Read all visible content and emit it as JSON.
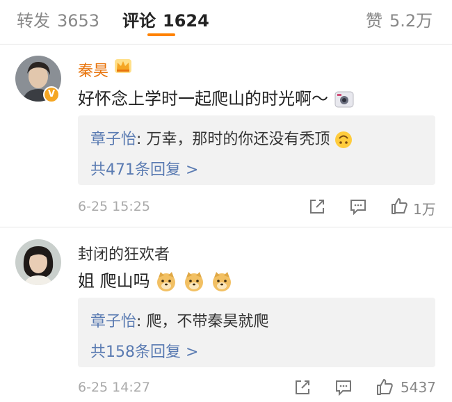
{
  "tabs": [
    {
      "label": "转发",
      "count": "3653"
    },
    {
      "label": "评论",
      "count": "1624"
    },
    {
      "label": "赞",
      "count": "5.2万"
    }
  ],
  "comments": [
    {
      "username": "秦昊",
      "text": "好怀念上学时一起爬山的时光啊～",
      "reply_author": "章子怡",
      "reply_text": "万幸，那时的你还没有秃顶",
      "reply_more": "共471条回复 >",
      "timestamp": "6-25 15:25",
      "likes": "1万"
    },
    {
      "username": "封闭的狂欢者",
      "text": "姐  爬山吗",
      "reply_author": "章子怡",
      "reply_text": "爬，不带秦昊就爬",
      "reply_more": "共158条回复 >",
      "timestamp": "6-25 14:27",
      "likes": "5437"
    }
  ],
  "colors": {
    "accent": "#ff8200",
    "vip_name": "#e8740c",
    "link": "#5a7bb2",
    "reply_bg": "#f2f2f2",
    "muted": "#888888"
  },
  "icons": [
    "crown-icon",
    "verified-badge-icon",
    "camera-emoji-icon",
    "upside-down-face-emoji-icon",
    "doge-emoji-icon",
    "share-icon",
    "comment-icon",
    "like-icon"
  ]
}
